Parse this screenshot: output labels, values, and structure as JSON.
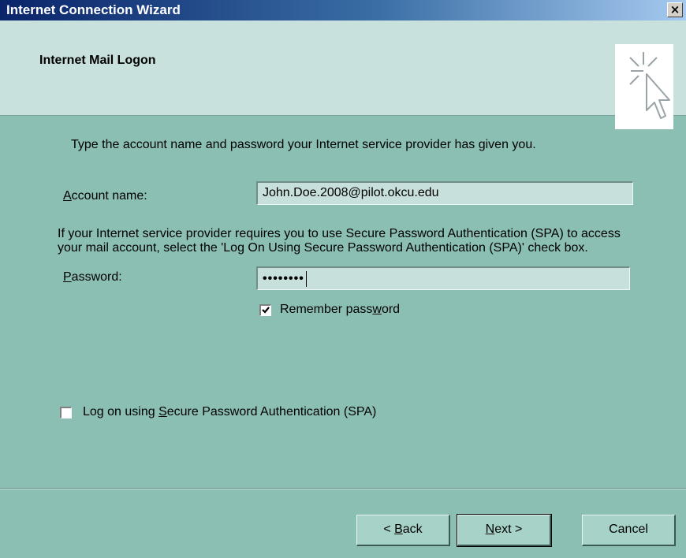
{
  "window": {
    "title": "Internet Connection Wizard",
    "close_glyph": "×"
  },
  "header": {
    "title": "Internet Mail Logon",
    "icon": "wizard-cursor-icon"
  },
  "content": {
    "intro": "Type the account name and password your Internet service provider has given you.",
    "account_label_key": "A",
    "account_label_rest": "ccount name:",
    "account_value": "John.Doe.2008@pilot.okcu.edu",
    "password_label_key": "P",
    "password_label_rest": "assword:",
    "password_value": "••••••••",
    "remember_label_pre": "Remember pass",
    "remember_label_key": "w",
    "remember_label_post": "ord",
    "remember_checked": true,
    "spa_paragraph": "If your Internet service provider requires you to use Secure Password Authentication (SPA) to access your mail account, select the 'Log On Using Secure Password Authentication (SPA)' check box.",
    "spa_label_pre": "Log on using ",
    "spa_label_key": "S",
    "spa_label_post": "ecure Password Authentication (SPA)",
    "spa_checked": false
  },
  "buttons": {
    "back_prefix": "< ",
    "back_key": "B",
    "back_rest": "ack",
    "next_key": "N",
    "next_rest": "ext >",
    "cancel": "Cancel"
  }
}
